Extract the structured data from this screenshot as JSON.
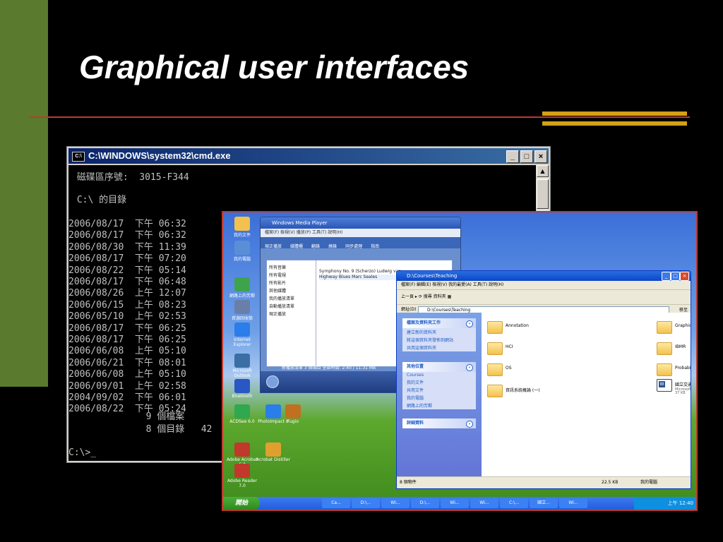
{
  "slide": {
    "title": "Graphical user interfaces"
  },
  "cmd": {
    "title": "C:\\WINDOWS\\system32\\cmd.exe",
    "icon": "C:\\",
    "controls": {
      "min": "_",
      "max": "□",
      "close": "×"
    },
    "header_line1": " 磁碟區序號:  3015-F344",
    "header_line2": " C:\\ 的目錄",
    "rows": [
      "2006/08/17  下午 06:32",
      "2006/08/17  下午 06:32",
      "2006/08/30  下午 11:39",
      "2006/08/17  下午 07:20",
      "2006/08/22  下午 05:14",
      "2006/08/17  下午 06:48",
      "2006/08/26  上午 12:07",
      "2006/06/15  上午 08:23",
      "2006/05/10  上午 02:53",
      "2006/08/17  下午 06:25",
      "2006/08/17  下午 06:25",
      "2006/06/08  上午 05:10",
      "2006/06/21  下午 08:01",
      "2006/06/08  上午 05:10",
      "2006/09/01  上午 02:58",
      "2004/09/02  下午 06:01",
      "2006/08/22  下午 05:24"
    ],
    "summary1": "              9 個檔案",
    "summary2": "              8 個目錄   42",
    "prompt": "C:\\>_"
  },
  "xp": {
    "desktop_icons": [
      "我的文件",
      "我的電腦",
      "網路上的芳鄰",
      "資源回收筒",
      "Internet Explorer",
      "Microsoft Outlook",
      "Bluetooth",
      "ACDSee 6.0",
      "Adobe Acrobat 6.0",
      "Adobe Reader 7.0"
    ],
    "desktop_icons2": [
      "PhotoImpact 8",
      "Acrobat Distiller",
      "Fugio"
    ],
    "taskbar": {
      "start": "開始",
      "items": [
        "Ca...",
        "D:\\...",
        "Wi...",
        "D:\\...",
        "Wi...",
        "Wi...",
        "C:\\...",
        "國立...",
        "Wi..."
      ],
      "clock": "上午 12:40"
    },
    "wmp": {
      "title": "Windows Media Player",
      "menu": "檔案(F)  檢視(V)  播放(P)  工具(T)  說明(H)",
      "tabs": [
        "現正播放",
        "媒體櫃",
        "翻錄",
        "燒錄",
        "同步處理",
        "指南"
      ],
      "tree": [
        "所有音樂",
        "所有電視",
        "所有影片",
        "其他媒體",
        "我的播放清單",
        "自動播放清單",
        "現正播放"
      ],
      "rows": [
        "Symphony No. 9 (Scherzo)  Ludwig van",
        "Highway Blues  Marc Seales"
      ],
      "status": "新播放清單  3 個項目  全部時間: 2:40 / 11.31 MB"
    },
    "explorer": {
      "title": "D:\\Courses\\Teaching",
      "menu": "檔案(F)  編輯(E)  檢視(V)  我的最愛(A)  工具(T)  說明(H)",
      "toolbar": "上一頁  ▸  ⟳  搜尋  資料夾  ▦",
      "address_label": "網址(D)",
      "address": "D:\\Courses\\Teaching",
      "go": "移至",
      "panel1_title": "檔案及資料夾工作",
      "panel1_items": [
        "建立新的資料夾",
        "將這個資料夾發佈到網站",
        "共用這個資料夾"
      ],
      "panel2_title": "其他位置",
      "panel2_items": [
        "Courses",
        "我的文件",
        "共用文件",
        "我的電腦",
        "網路上的芳鄰"
      ],
      "panel3_title": "詳細資料",
      "folders": [
        "Annotation",
        "Graphics",
        "HCI",
        "IBMR",
        "OS",
        "Probability",
        "資訊系統概論 (一)"
      ],
      "doc_name": "國立交通大學課程授課.doc",
      "doc_type": "Microsoft Word 文件",
      "doc_size": "37 KB",
      "status_left": "8 個物件",
      "status_mid": "22.5 KB",
      "status_right": "我的電腦"
    }
  }
}
